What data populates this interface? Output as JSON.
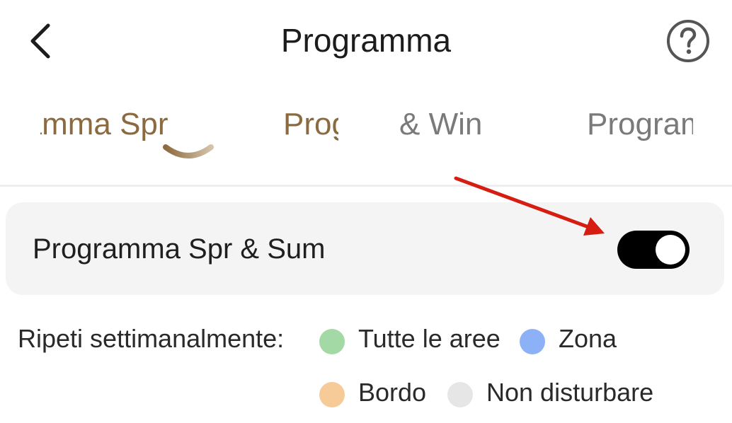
{
  "header": {
    "title": "Programma",
    "back_icon": "chevron-left-icon",
    "help_icon": "question-circle-icon"
  },
  "tabs": [
    {
      "label": "Programma Spr & Sum",
      "visible_text": "pr & Sum",
      "selected": true
    },
    {
      "label": "Programma Aut",
      "visible_text": "Prog",
      "selected": false
    },
    {
      "label": "Aut & Win",
      "visible_text": "& Win",
      "selected": false
    },
    {
      "label": "Programma",
      "visible_text": "Prograr",
      "selected": false
    }
  ],
  "card": {
    "label": "Programma Spr & Sum",
    "toggle_on": true
  },
  "legend": {
    "label": "Ripeti settimanalmente:",
    "items": [
      {
        "text": "Tutte le aree",
        "color": "#a3d9a5"
      },
      {
        "text": "Zona",
        "color": "#8db1f7"
      },
      {
        "text": "Bordo",
        "color": "#f6cb98"
      },
      {
        "text": "Non disturbare",
        "color": "#e6e6e6"
      }
    ]
  },
  "colors": {
    "accent": "#8c6a3f",
    "annotation_arrow": "#d61d12"
  }
}
